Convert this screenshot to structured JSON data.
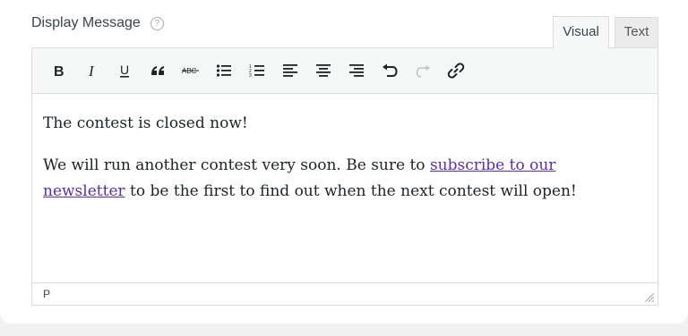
{
  "field": {
    "label": "Display Message",
    "help_icon": "?"
  },
  "tabs": [
    {
      "label": "Visual",
      "active": true
    },
    {
      "label": "Text",
      "active": false
    }
  ],
  "toolbar": {
    "buttons": [
      {
        "name": "bold-button",
        "icon": "bold-icon",
        "glyph": "B"
      },
      {
        "name": "italic-button",
        "icon": "italic-icon",
        "glyph": "I"
      },
      {
        "name": "underline-button",
        "icon": "underline-icon",
        "glyph": "U"
      },
      {
        "name": "blockquote-button",
        "icon": "quote-icon",
        "glyph": "66"
      },
      {
        "name": "strikethrough-button",
        "icon": "strikethrough-icon",
        "glyph": "ABC"
      },
      {
        "name": "bulleted-list-button",
        "icon": "bullet-list-icon"
      },
      {
        "name": "numbered-list-button",
        "icon": "numbered-list-icon"
      },
      {
        "name": "align-left-button",
        "icon": "align-left-icon"
      },
      {
        "name": "align-center-button",
        "icon": "align-center-icon"
      },
      {
        "name": "align-right-button",
        "icon": "align-right-icon"
      },
      {
        "name": "undo-button",
        "icon": "undo-icon"
      },
      {
        "name": "redo-button",
        "icon": "redo-icon",
        "disabled": true
      },
      {
        "name": "insert-link-button",
        "icon": "link-icon"
      }
    ]
  },
  "content": {
    "paragraph1": "The contest is closed now!",
    "paragraph2_before": "We will run another contest very soon. Be sure to ",
    "paragraph2_link": "subscribe to our newsletter",
    "paragraph2_after": " to be the first to find out when the next contest will open!"
  },
  "statusbar": {
    "path": "P"
  },
  "colors": {
    "link": "#5b2ea6",
    "toolbar_bg": "#f6f7f7",
    "border": "#dcdcde"
  }
}
